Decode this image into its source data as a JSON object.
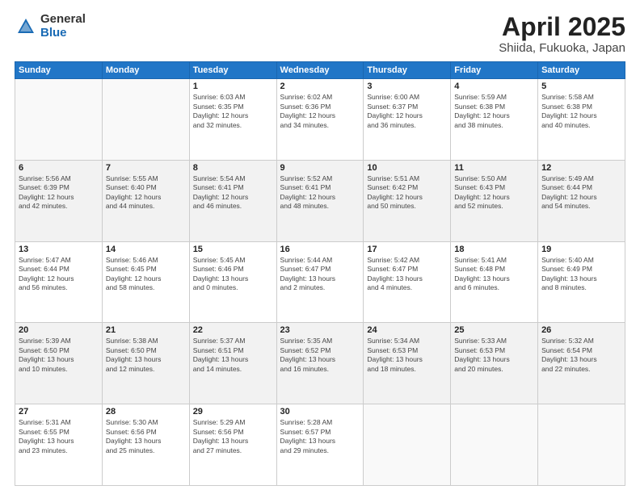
{
  "header": {
    "logo_general": "General",
    "logo_blue": "Blue",
    "title": "April 2025",
    "location": "Shiida, Fukuoka, Japan"
  },
  "weekdays": [
    "Sunday",
    "Monday",
    "Tuesday",
    "Wednesday",
    "Thursday",
    "Friday",
    "Saturday"
  ],
  "weeks": [
    [
      {
        "day": "",
        "info": ""
      },
      {
        "day": "",
        "info": ""
      },
      {
        "day": "1",
        "info": "Sunrise: 6:03 AM\nSunset: 6:35 PM\nDaylight: 12 hours\nand 32 minutes."
      },
      {
        "day": "2",
        "info": "Sunrise: 6:02 AM\nSunset: 6:36 PM\nDaylight: 12 hours\nand 34 minutes."
      },
      {
        "day": "3",
        "info": "Sunrise: 6:00 AM\nSunset: 6:37 PM\nDaylight: 12 hours\nand 36 minutes."
      },
      {
        "day": "4",
        "info": "Sunrise: 5:59 AM\nSunset: 6:38 PM\nDaylight: 12 hours\nand 38 minutes."
      },
      {
        "day": "5",
        "info": "Sunrise: 5:58 AM\nSunset: 6:38 PM\nDaylight: 12 hours\nand 40 minutes."
      }
    ],
    [
      {
        "day": "6",
        "info": "Sunrise: 5:56 AM\nSunset: 6:39 PM\nDaylight: 12 hours\nand 42 minutes."
      },
      {
        "day": "7",
        "info": "Sunrise: 5:55 AM\nSunset: 6:40 PM\nDaylight: 12 hours\nand 44 minutes."
      },
      {
        "day": "8",
        "info": "Sunrise: 5:54 AM\nSunset: 6:41 PM\nDaylight: 12 hours\nand 46 minutes."
      },
      {
        "day": "9",
        "info": "Sunrise: 5:52 AM\nSunset: 6:41 PM\nDaylight: 12 hours\nand 48 minutes."
      },
      {
        "day": "10",
        "info": "Sunrise: 5:51 AM\nSunset: 6:42 PM\nDaylight: 12 hours\nand 50 minutes."
      },
      {
        "day": "11",
        "info": "Sunrise: 5:50 AM\nSunset: 6:43 PM\nDaylight: 12 hours\nand 52 minutes."
      },
      {
        "day": "12",
        "info": "Sunrise: 5:49 AM\nSunset: 6:44 PM\nDaylight: 12 hours\nand 54 minutes."
      }
    ],
    [
      {
        "day": "13",
        "info": "Sunrise: 5:47 AM\nSunset: 6:44 PM\nDaylight: 12 hours\nand 56 minutes."
      },
      {
        "day": "14",
        "info": "Sunrise: 5:46 AM\nSunset: 6:45 PM\nDaylight: 12 hours\nand 58 minutes."
      },
      {
        "day": "15",
        "info": "Sunrise: 5:45 AM\nSunset: 6:46 PM\nDaylight: 13 hours\nand 0 minutes."
      },
      {
        "day": "16",
        "info": "Sunrise: 5:44 AM\nSunset: 6:47 PM\nDaylight: 13 hours\nand 2 minutes."
      },
      {
        "day": "17",
        "info": "Sunrise: 5:42 AM\nSunset: 6:47 PM\nDaylight: 13 hours\nand 4 minutes."
      },
      {
        "day": "18",
        "info": "Sunrise: 5:41 AM\nSunset: 6:48 PM\nDaylight: 13 hours\nand 6 minutes."
      },
      {
        "day": "19",
        "info": "Sunrise: 5:40 AM\nSunset: 6:49 PM\nDaylight: 13 hours\nand 8 minutes."
      }
    ],
    [
      {
        "day": "20",
        "info": "Sunrise: 5:39 AM\nSunset: 6:50 PM\nDaylight: 13 hours\nand 10 minutes."
      },
      {
        "day": "21",
        "info": "Sunrise: 5:38 AM\nSunset: 6:50 PM\nDaylight: 13 hours\nand 12 minutes."
      },
      {
        "day": "22",
        "info": "Sunrise: 5:37 AM\nSunset: 6:51 PM\nDaylight: 13 hours\nand 14 minutes."
      },
      {
        "day": "23",
        "info": "Sunrise: 5:35 AM\nSunset: 6:52 PM\nDaylight: 13 hours\nand 16 minutes."
      },
      {
        "day": "24",
        "info": "Sunrise: 5:34 AM\nSunset: 6:53 PM\nDaylight: 13 hours\nand 18 minutes."
      },
      {
        "day": "25",
        "info": "Sunrise: 5:33 AM\nSunset: 6:53 PM\nDaylight: 13 hours\nand 20 minutes."
      },
      {
        "day": "26",
        "info": "Sunrise: 5:32 AM\nSunset: 6:54 PM\nDaylight: 13 hours\nand 22 minutes."
      }
    ],
    [
      {
        "day": "27",
        "info": "Sunrise: 5:31 AM\nSunset: 6:55 PM\nDaylight: 13 hours\nand 23 minutes."
      },
      {
        "day": "28",
        "info": "Sunrise: 5:30 AM\nSunset: 6:56 PM\nDaylight: 13 hours\nand 25 minutes."
      },
      {
        "day": "29",
        "info": "Sunrise: 5:29 AM\nSunset: 6:56 PM\nDaylight: 13 hours\nand 27 minutes."
      },
      {
        "day": "30",
        "info": "Sunrise: 5:28 AM\nSunset: 6:57 PM\nDaylight: 13 hours\nand 29 minutes."
      },
      {
        "day": "",
        "info": ""
      },
      {
        "day": "",
        "info": ""
      },
      {
        "day": "",
        "info": ""
      }
    ]
  ]
}
